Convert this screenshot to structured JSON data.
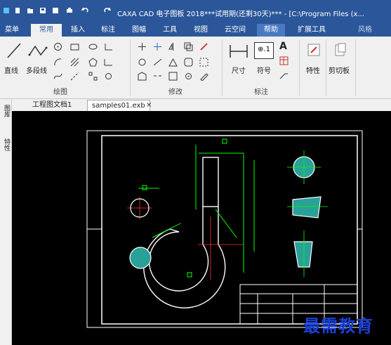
{
  "titlebar": {
    "title": "CAXA CAD 电子图板 2018***试用期(还剩30天)*** - [C:\\Program Files (x..."
  },
  "menu": {
    "tabs": [
      "菜单",
      "常用",
      "插入",
      "标注",
      "图幅",
      "工具",
      "视图",
      "云空间",
      "帮助",
      "扩展工具",
      "风格"
    ]
  },
  "ribbon": {
    "draw": {
      "line": "直线",
      "polyline": "多段线",
      "group": "绘图"
    },
    "modify": {
      "group": "修改"
    },
    "annotate": {
      "dimension": "尺寸",
      "symbol": "符号",
      "group": "标注"
    },
    "props": {
      "properties": "特性"
    },
    "clipboard": {
      "paste": "剪切板"
    },
    "symbol_text": "⊕.1",
    "text_tool": "A"
  },
  "doctabs": {
    "tab1": "工程图文档1",
    "tab2": "samples01.exb",
    "close": "×"
  },
  "leftpanel": {
    "layers": "图库",
    "props": "特性"
  },
  "watermark": "最需教育",
  "colors": {
    "accent": "#2b579a",
    "canvas": "#000000",
    "hatch": "#2aa198",
    "border": "#ffffff",
    "dim": "#00ff00"
  }
}
